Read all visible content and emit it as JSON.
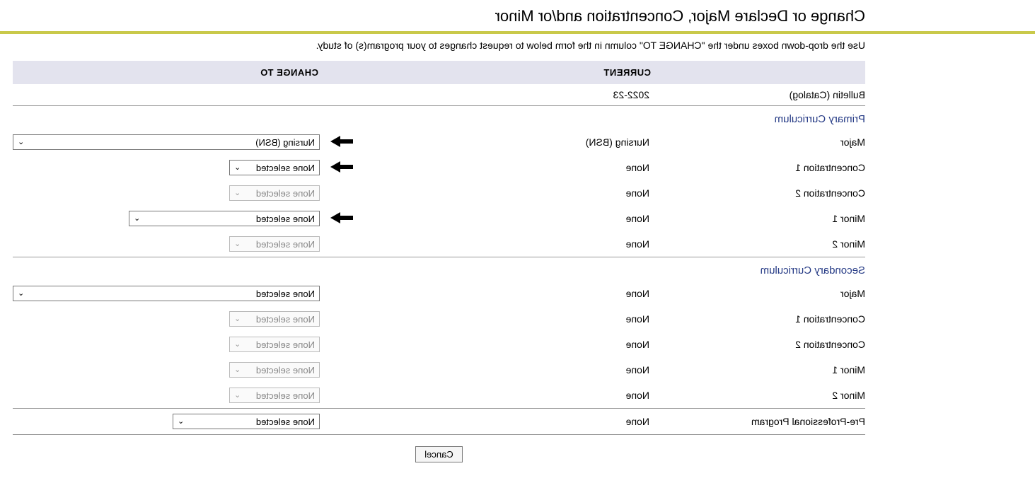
{
  "title": "Change or Declare Major, Concentration and/or Minor",
  "instructions": "Use the drop-down boxes under the \"CHANGE TO\" column in the form below to request changes to your program(s) of study.",
  "headers": {
    "current": "CURRENT",
    "change_to": "CHANGE TO"
  },
  "bulletin": {
    "label": "Bulletin (Catalog)",
    "value": "2022-23"
  },
  "primary": {
    "title": "Primary Curriculum",
    "rows": [
      {
        "label": "Major",
        "current": "Nursing (BSN)",
        "select": {
          "text": "Nursing (BSN)",
          "enabled": true,
          "width": "full",
          "arrow": true
        }
      },
      {
        "label": "Concentration 1",
        "current": "None",
        "select": {
          "text": "None selected",
          "enabled": true,
          "width": "128",
          "arrow": true
        }
      },
      {
        "label": "Concentration 2",
        "current": "None",
        "select": {
          "text": "None selected",
          "enabled": false,
          "width": "128",
          "arrow": false
        }
      },
      {
        "label": "Minor 1",
        "current": "None",
        "select": {
          "text": "None selected",
          "enabled": true,
          "width": "270",
          "arrow": true
        }
      },
      {
        "label": "Minor 2",
        "current": "None",
        "select": {
          "text": "None selected",
          "enabled": false,
          "width": "128",
          "arrow": false
        }
      }
    ]
  },
  "secondary": {
    "title": "Secondary Curriculum",
    "rows": [
      {
        "label": "Major",
        "current": "None",
        "select": {
          "text": "None selected",
          "enabled": true,
          "width": "full",
          "arrow": false
        }
      },
      {
        "label": "Concentration 1",
        "current": "None",
        "select": {
          "text": "None selected",
          "enabled": false,
          "width": "128",
          "arrow": false
        }
      },
      {
        "label": "Concentration 2",
        "current": "None",
        "select": {
          "text": "None selected",
          "enabled": false,
          "width": "128",
          "arrow": false
        }
      },
      {
        "label": "Minor 1",
        "current": "None",
        "select": {
          "text": "None selected",
          "enabled": false,
          "width": "128",
          "arrow": false
        }
      },
      {
        "label": "Minor 2",
        "current": "None",
        "select": {
          "text": "None selected",
          "enabled": false,
          "width": "128",
          "arrow": false
        }
      }
    ]
  },
  "preprof": {
    "label": "Pre-Professional Program",
    "current": "None",
    "select": {
      "text": "None selected",
      "enabled": true,
      "width": "208",
      "arrow": false
    }
  },
  "buttons": {
    "cancel": "Cancel"
  }
}
